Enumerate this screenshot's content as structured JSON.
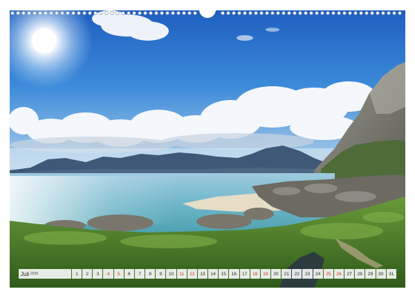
{
  "calendar": {
    "month": "Juli",
    "year": "2026",
    "days": [
      {
        "n": "1",
        "weekend": false
      },
      {
        "n": "2",
        "weekend": false
      },
      {
        "n": "3",
        "weekend": false
      },
      {
        "n": "4",
        "weekend": true
      },
      {
        "n": "5",
        "weekend": true
      },
      {
        "n": "6",
        "weekend": false
      },
      {
        "n": "7",
        "weekend": false
      },
      {
        "n": "8",
        "weekend": false
      },
      {
        "n": "9",
        "weekend": false
      },
      {
        "n": "10",
        "weekend": false
      },
      {
        "n": "11",
        "weekend": true
      },
      {
        "n": "12",
        "weekend": true
      },
      {
        "n": "13",
        "weekend": false
      },
      {
        "n": "14",
        "weekend": false
      },
      {
        "n": "15",
        "weekend": false
      },
      {
        "n": "16",
        "weekend": false
      },
      {
        "n": "17",
        "weekend": false
      },
      {
        "n": "18",
        "weekend": true
      },
      {
        "n": "19",
        "weekend": true
      },
      {
        "n": "20",
        "weekend": false
      },
      {
        "n": "21",
        "weekend": false
      },
      {
        "n": "22",
        "weekend": false
      },
      {
        "n": "23",
        "weekend": false
      },
      {
        "n": "24",
        "weekend": false
      },
      {
        "n": "25",
        "weekend": true
      },
      {
        "n": "26",
        "weekend": true
      },
      {
        "n": "27",
        "weekend": false
      },
      {
        "n": "28",
        "weekend": false
      },
      {
        "n": "29",
        "weekend": false
      },
      {
        "n": "30",
        "weekend": false
      },
      {
        "n": "31",
        "weekend": false
      }
    ]
  },
  "colors": {
    "weekend": "#d12b2b",
    "sky_top": "#1f5fbf",
    "sea": "#6fb6c9"
  }
}
